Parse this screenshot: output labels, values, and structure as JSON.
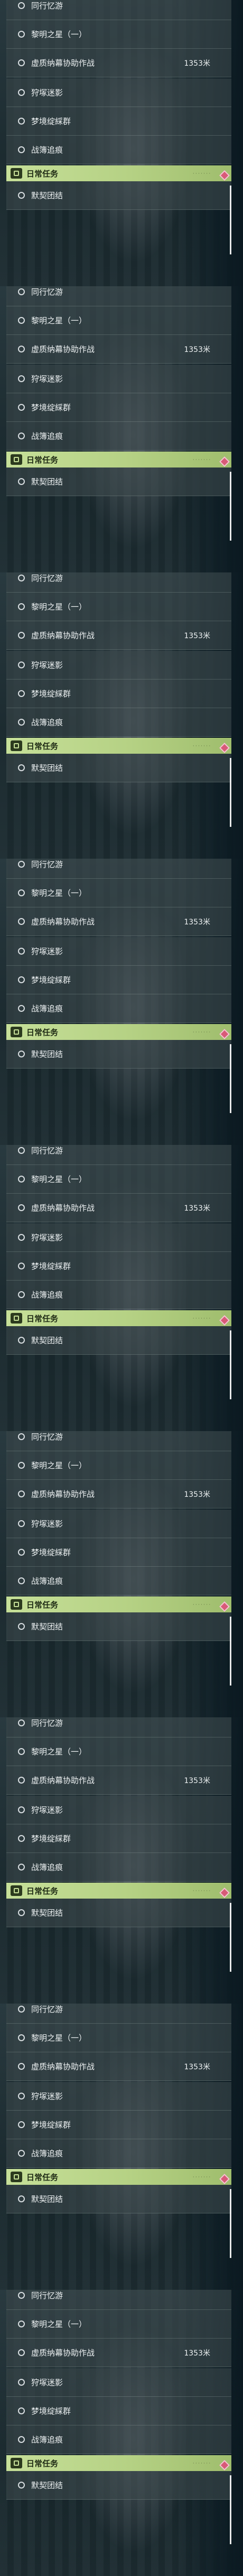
{
  "tiles_count": 9,
  "quest_rows": [
    {
      "label": "同行忆游",
      "meta": ""
    },
    {
      "label": "黎明之星（一）",
      "meta": ""
    },
    {
      "label": "虚质纳幕协助作战",
      "meta": "1353米"
    },
    {
      "label": "狩塚迷影",
      "meta": ""
    },
    {
      "label": "梦境绽綵群",
      "meta": ""
    },
    {
      "label": "战簿追痕",
      "meta": ""
    }
  ],
  "daily_header": {
    "title": "日常任务",
    "subtitle": "· · · · · · ·"
  },
  "daily_rows": [
    {
      "label": "默契团结",
      "meta": ""
    }
  ],
  "colors": {
    "header_green": "#c6df98",
    "alert_diamond": "#d85a78",
    "row_bg": "rgba(60,72,76,0.62)"
  },
  "icons": {
    "row_status": "circle-outline-icon",
    "header": "daily-task-icon",
    "alert": "diamond-alert-icon"
  }
}
